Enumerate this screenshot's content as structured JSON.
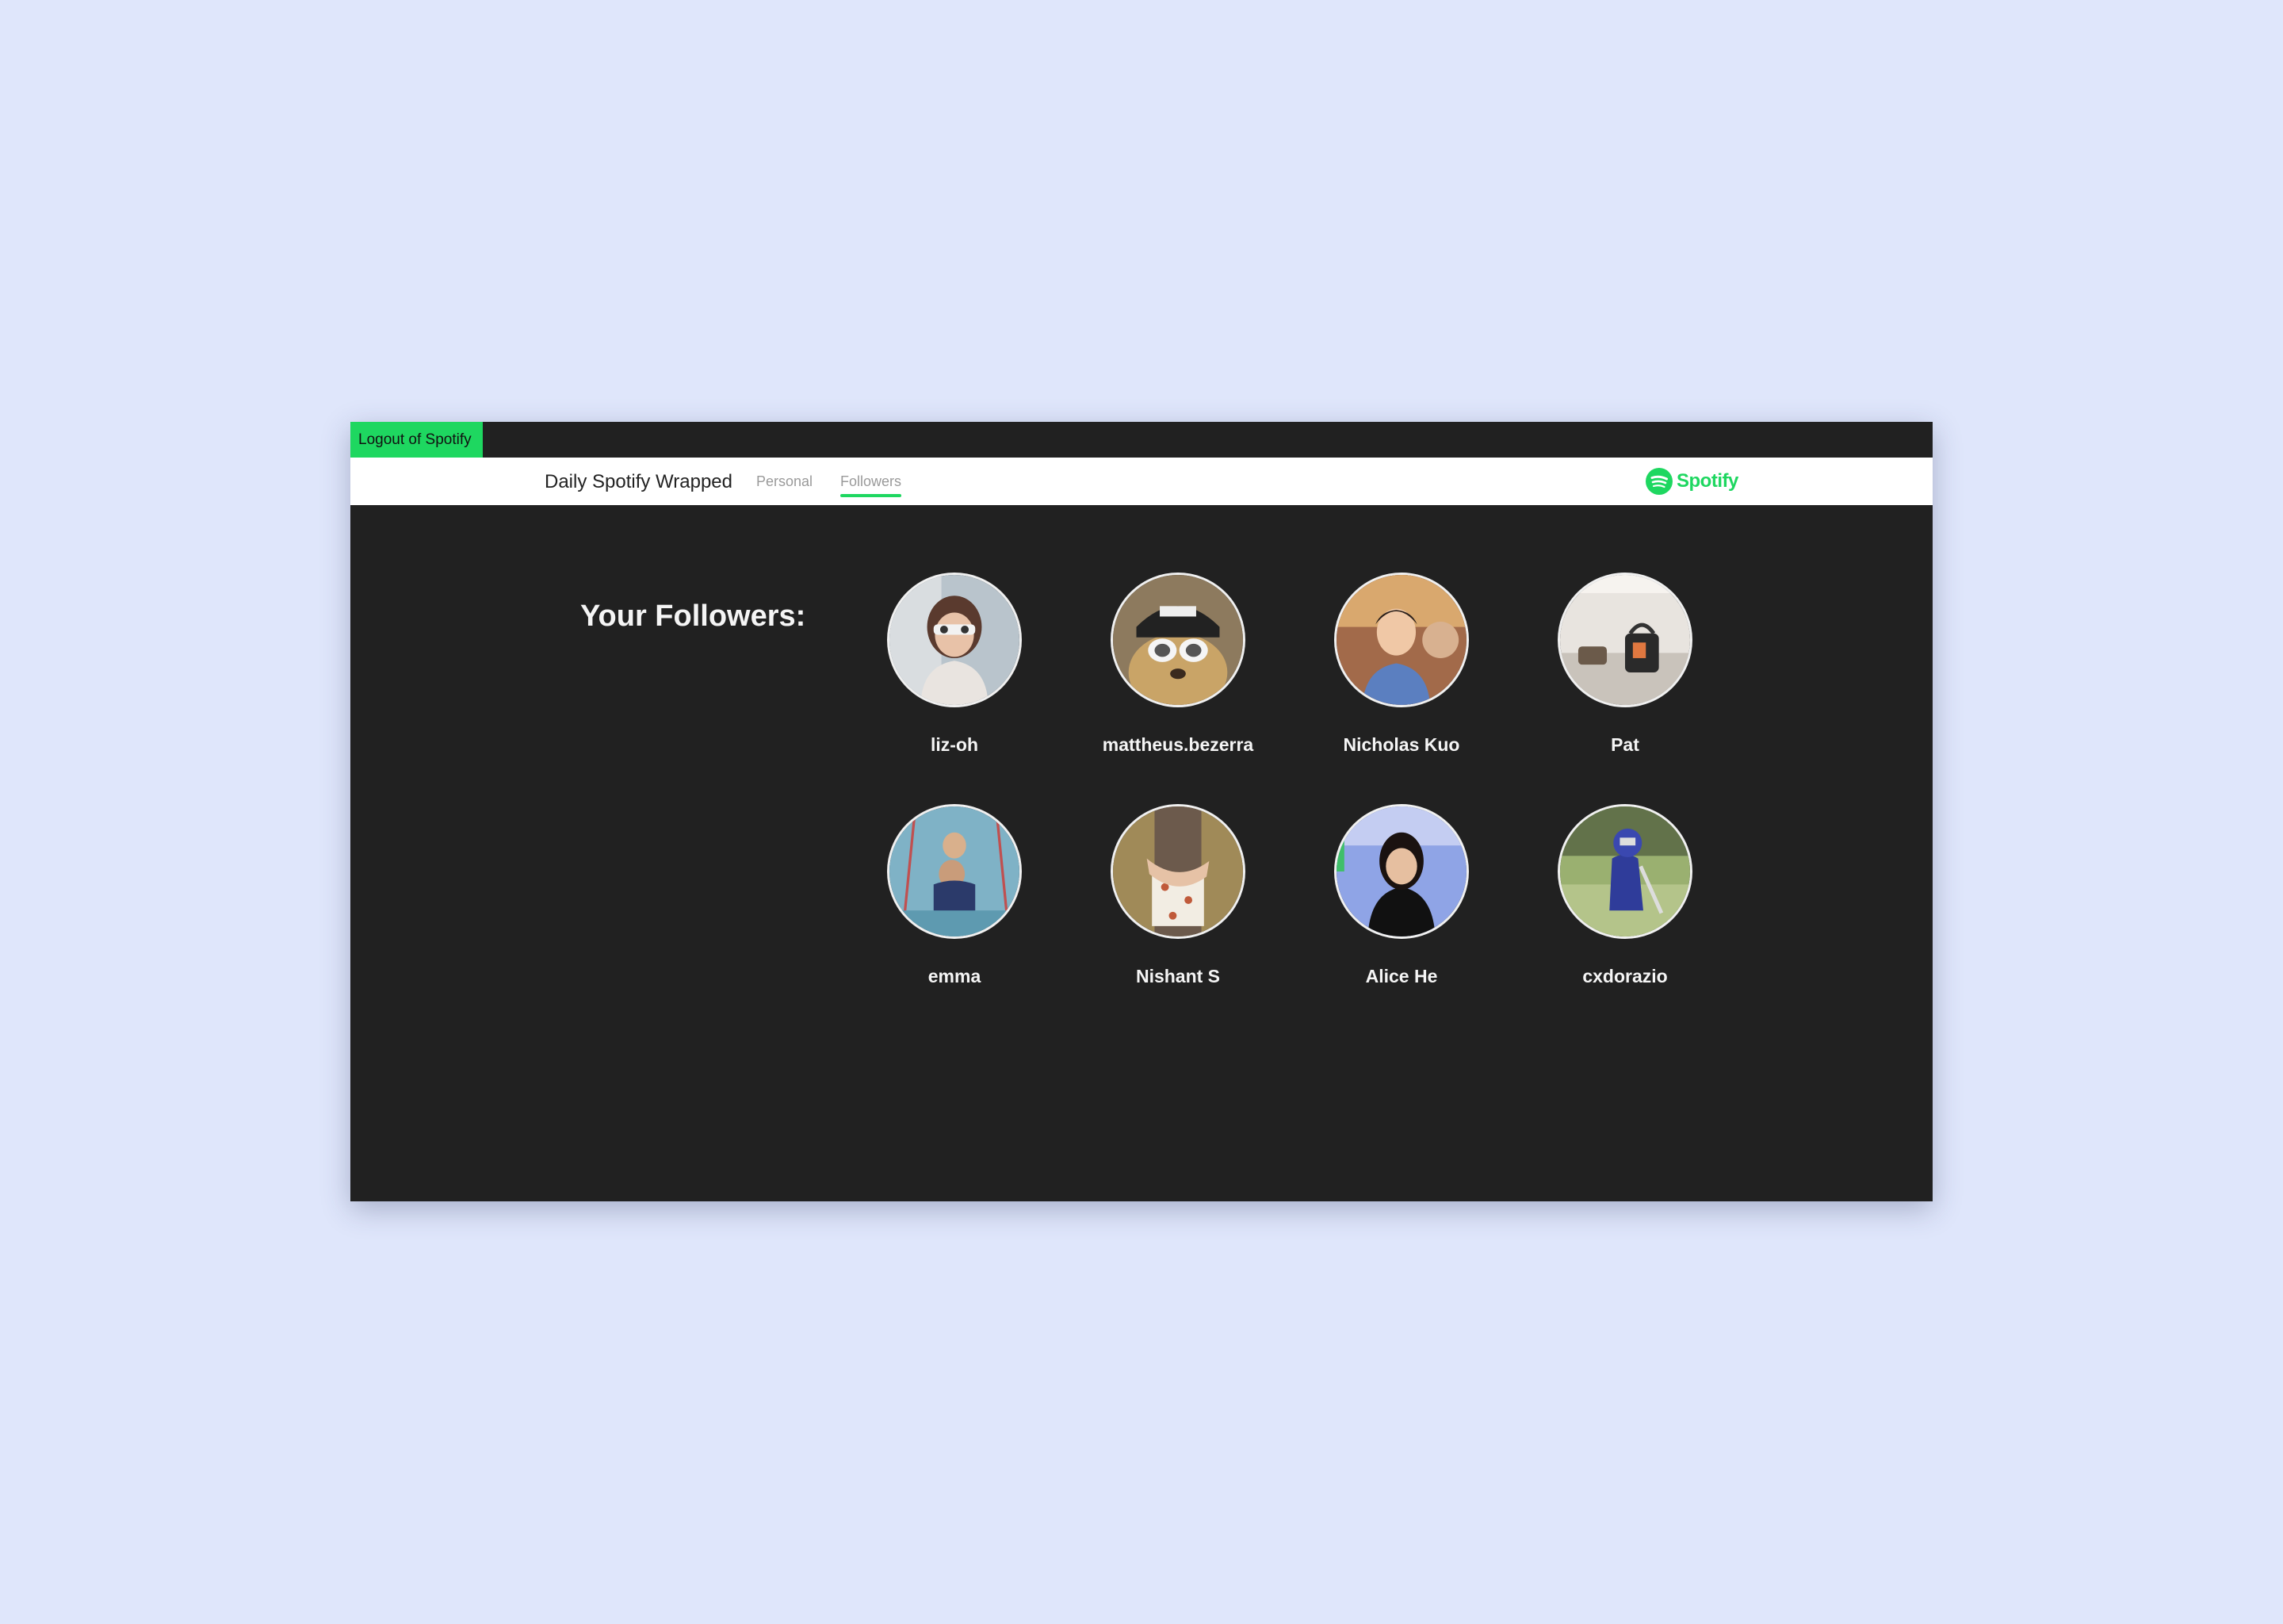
{
  "header": {
    "logout_label": "Logout of Spotify",
    "brand_title": "Daily Spotify Wrapped",
    "tabs": [
      {
        "label": "Personal",
        "active": false
      },
      {
        "label": "Followers",
        "active": true
      }
    ],
    "logo_text": "Spotify"
  },
  "main": {
    "title": "Your Followers:",
    "followers": [
      {
        "name": "liz-oh"
      },
      {
        "name": "mattheus.bezerra"
      },
      {
        "name": "Nicholas Kuo"
      },
      {
        "name": "Pat"
      },
      {
        "name": "emma"
      },
      {
        "name": "Nishant S"
      },
      {
        "name": "Alice He"
      },
      {
        "name": "cxdorazio"
      }
    ]
  },
  "colors": {
    "accent": "#1ed760",
    "page_background": "#dfe6fb",
    "app_background": "#212121"
  }
}
